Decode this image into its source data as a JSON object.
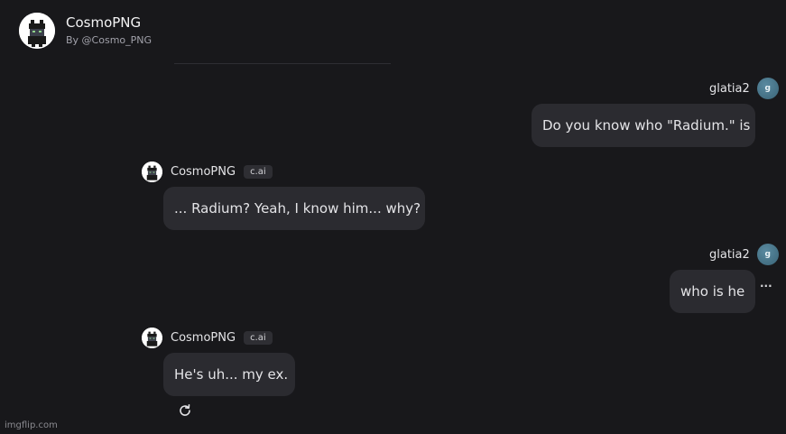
{
  "header": {
    "bot_name": "CosmoPNG",
    "byline": "By @Cosmo_PNG"
  },
  "messages": [
    {
      "role": "user",
      "author": "glatia2",
      "avatar_letter": "g",
      "text": "Do you know who \"Radium.\" is"
    },
    {
      "role": "bot",
      "author": "CosmoPNG",
      "tag": "c.ai",
      "text": "... Radium? Yeah, I know him... why?"
    },
    {
      "role": "user",
      "author": "glatia2",
      "avatar_letter": "g",
      "text": "who is he"
    },
    {
      "role": "bot",
      "author": "CosmoPNG",
      "tag": "c.ai",
      "text": "He's uh... my ex."
    }
  ],
  "controls": {
    "more_label": "···",
    "refresh_icon": "refresh-icon"
  },
  "watermark": "imgflip.com",
  "colors": {
    "background": "#18181b",
    "bubble": "#2b2b30",
    "user_avatar": "#4a7a8e",
    "tag_bg": "#2e2e33"
  }
}
